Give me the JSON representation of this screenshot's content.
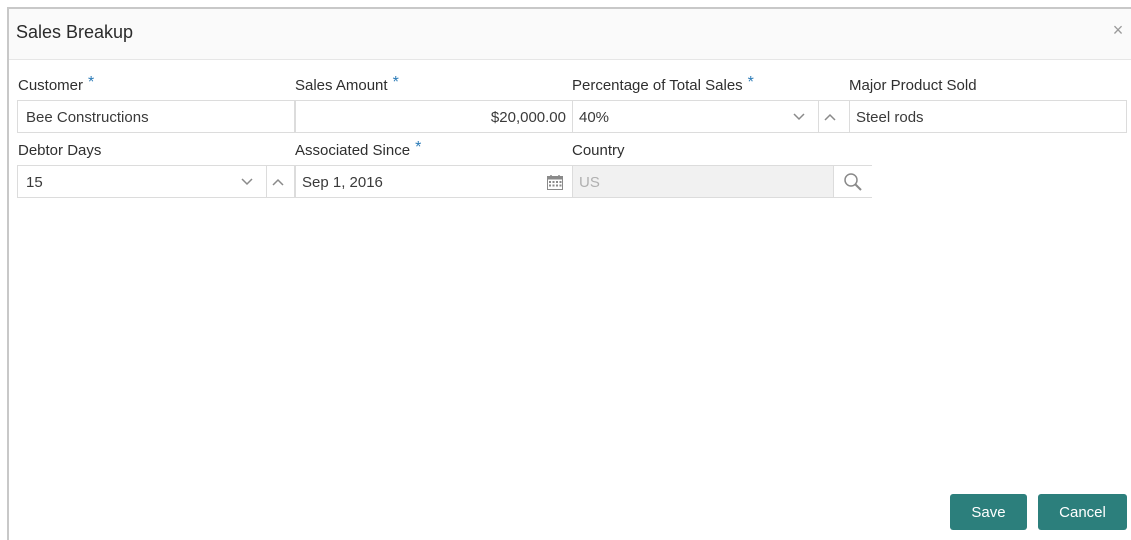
{
  "dialog": {
    "title": "Sales Breakup",
    "close_glyph": "×"
  },
  "required_marker": "*",
  "fields": {
    "customer": {
      "label": "Customer",
      "required": true,
      "value": "Bee Constructions"
    },
    "sales_amount": {
      "label": "Sales Amount",
      "required": true,
      "value": "$20,000.00"
    },
    "percentage": {
      "label": "Percentage of Total Sales",
      "required": true,
      "value": "40%"
    },
    "major_product": {
      "label": "Major Product Sold",
      "required": false,
      "value": "Steel rods"
    },
    "debtor_days": {
      "label": "Debtor Days",
      "required": false,
      "value": "15"
    },
    "associated_since": {
      "label": "Associated Since",
      "required": true,
      "value": "Sep 1, 2016"
    },
    "country": {
      "label": "Country",
      "required": false,
      "value": "US",
      "disabled": true
    }
  },
  "buttons": {
    "save": "Save",
    "cancel": "Cancel"
  },
  "icons": {
    "spinner_down": "chevron-down-icon",
    "spinner_up": "chevron-up-icon",
    "calendar": "calendar-icon",
    "search": "search-icon",
    "close": "close-icon"
  },
  "colors": {
    "primary_button": "#2c7f7c",
    "required_asterisk": "#2a7ab7",
    "disabled_field_bg": "#f1f1f1"
  }
}
